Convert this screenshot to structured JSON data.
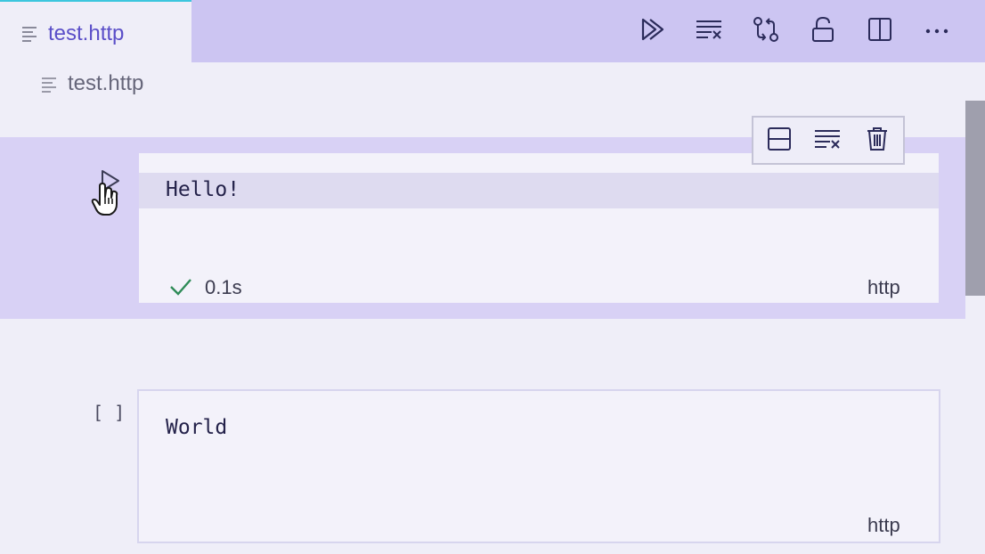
{
  "tab": {
    "label": "test.http",
    "icon": "file-lines-icon"
  },
  "toolbar": {
    "actions": [
      {
        "name": "run-all",
        "icon": "run-all-icon"
      },
      {
        "name": "clear-all-outputs",
        "icon": "clear-all-icon"
      },
      {
        "name": "compare-changes",
        "icon": "git-compare-icon"
      },
      {
        "name": "lock",
        "icon": "unlock-icon"
      },
      {
        "name": "split-editor",
        "icon": "split-editor-icon"
      },
      {
        "name": "more-actions",
        "icon": "ellipsis-icon"
      }
    ]
  },
  "breadcrumb": {
    "label": "test.http",
    "icon": "file-lines-icon"
  },
  "cell_toolbar": {
    "actions": [
      {
        "name": "split-cell",
        "icon": "split-cell-icon"
      },
      {
        "name": "clear-output",
        "icon": "clear-output-icon"
      },
      {
        "name": "delete-cell",
        "icon": "trash-icon"
      }
    ]
  },
  "cells": [
    {
      "code": "Hello!",
      "status": "0.1s",
      "status_icon": "check-icon",
      "language": "http",
      "selected": true
    },
    {
      "code": "World",
      "execution_count": "[ ]",
      "language": "http",
      "selected": false
    }
  ],
  "colors": {
    "accent": "#5b4fc8",
    "tab_bar": "#ccc5f2",
    "selected_cell": "#d8d1f5",
    "success": "#2e8b57",
    "tab_indicator": "#3cc6de"
  }
}
